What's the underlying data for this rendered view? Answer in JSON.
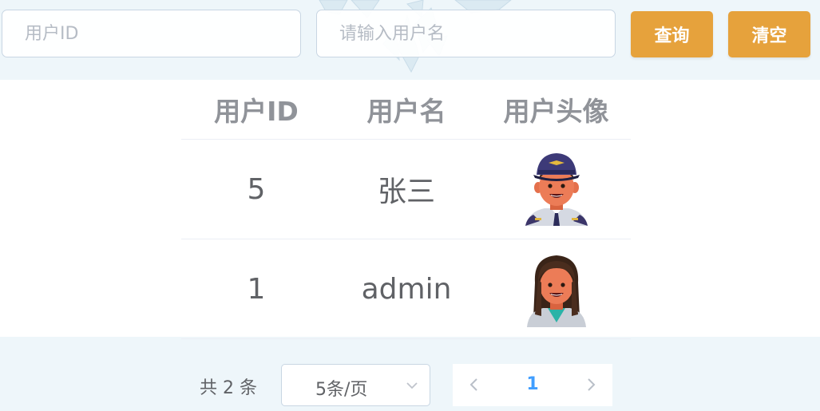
{
  "search": {
    "user_id_placeholder": "用户ID",
    "username_placeholder": "请输入用户名",
    "query_label": "查询",
    "clear_label": "清空"
  },
  "table": {
    "headers": [
      "用户ID",
      "用户名",
      "用户头像"
    ],
    "rows": [
      {
        "id": "5",
        "username": "张三",
        "avatar": "pilot-avatar"
      },
      {
        "id": "1",
        "username": "admin",
        "avatar": "long-hair-avatar"
      }
    ]
  },
  "pagination": {
    "total_text": "共 2 条",
    "page_size": "5条/页",
    "current_page": "1"
  },
  "colors": {
    "button": "#e6a23c",
    "active_page": "#409eff",
    "header_text": "#909399",
    "body_text": "#606266"
  }
}
